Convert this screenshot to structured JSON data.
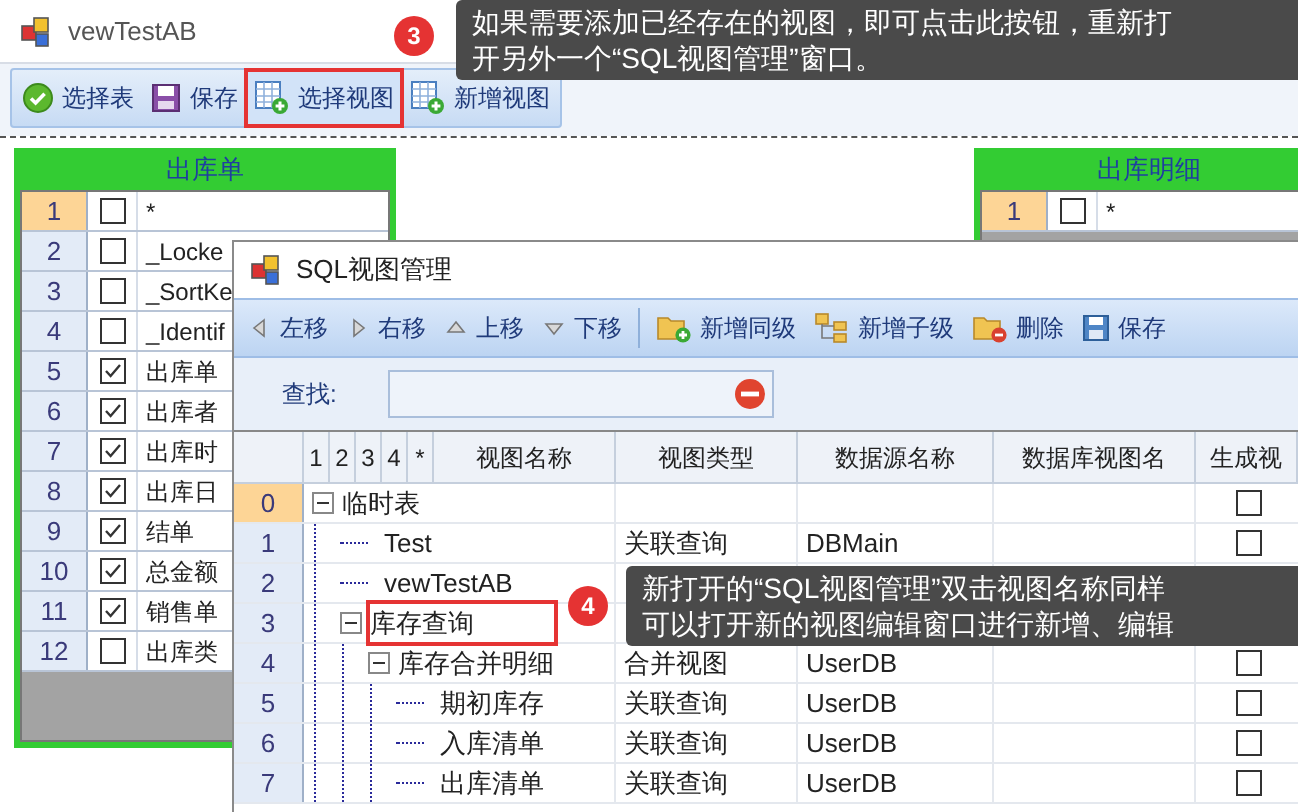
{
  "window": {
    "title": "vewTestAB"
  },
  "toolbar": [
    {
      "label": "选择表",
      "highlighted": false
    },
    {
      "label": "保存",
      "highlighted": false
    },
    {
      "label": "选择视图",
      "highlighted": true
    },
    {
      "label": "新增视图",
      "highlighted": false
    }
  ],
  "canvas_tables": [
    {
      "title": "出库单",
      "rows": [
        {
          "number": "1",
          "selected": true,
          "checked": false,
          "name": "*"
        },
        {
          "number": "2",
          "selected": false,
          "checked": false,
          "name": "_Locke"
        },
        {
          "number": "3",
          "selected": false,
          "checked": false,
          "name": "_SortKe"
        },
        {
          "number": "4",
          "selected": false,
          "checked": false,
          "name": "_Identif"
        },
        {
          "number": "5",
          "selected": false,
          "checked": true,
          "name": "出库单"
        },
        {
          "number": "6",
          "selected": false,
          "checked": true,
          "name": "出库者"
        },
        {
          "number": "7",
          "selected": false,
          "checked": true,
          "name": "出库时"
        },
        {
          "number": "8",
          "selected": false,
          "checked": true,
          "name": "出库日"
        },
        {
          "number": "9",
          "selected": false,
          "checked": true,
          "name": "结单"
        },
        {
          "number": "10",
          "selected": false,
          "checked": true,
          "name": "总金额"
        },
        {
          "number": "11",
          "selected": false,
          "checked": true,
          "name": "销售单"
        },
        {
          "number": "12",
          "selected": false,
          "checked": false,
          "name": "出库类"
        }
      ]
    },
    {
      "title": "出库明细",
      "rows": [
        {
          "number": "1",
          "selected": true,
          "checked": false,
          "name": "*"
        }
      ]
    }
  ],
  "sql_window": {
    "title": "SQL视图管理",
    "toolbar": [
      {
        "label": "左移"
      },
      {
        "label": "右移"
      },
      {
        "label": "上移"
      },
      {
        "label": "下移"
      },
      {
        "label": "新增同级"
      },
      {
        "label": "新增子级"
      },
      {
        "label": "删除"
      },
      {
        "label": "保存"
      }
    ],
    "search": {
      "label": "查找:"
    },
    "level_buttons": [
      "1",
      "2",
      "3",
      "4",
      "*"
    ],
    "columns": [
      "视图名称",
      "视图类型",
      "数据源名称",
      "数据库视图名",
      "生成视"
    ],
    "tree": [
      {
        "row": "0",
        "name": "临时表",
        "selected": true,
        "expanded": true,
        "checked": false,
        "children": [
          {
            "row": "1",
            "name": "Test",
            "selected": false,
            "type": "关联查询",
            "source": "DBMain",
            "checked": false
          },
          {
            "row": "2",
            "name": "vewTestAB",
            "selected": false
          },
          {
            "row": "3",
            "name": "库存查询",
            "selected": false,
            "highlighted": true,
            "expanded": true,
            "children": [
              {
                "row": "4",
                "name": "库存合并明细",
                "selected": false,
                "expanded": true,
                "type": "合并视图",
                "source": "UserDB",
                "checked": false,
                "children": [
                  {
                    "row": "5",
                    "name": "期初库存",
                    "selected": false,
                    "type": "关联查询",
                    "source": "UserDB",
                    "checked": false
                  },
                  {
                    "row": "6",
                    "name": "入库清单",
                    "selected": false,
                    "type": "关联查询",
                    "source": "UserDB",
                    "checked": false
                  },
                  {
                    "row": "7",
                    "name": "出库清单",
                    "selected": false,
                    "type": "关联查询",
                    "source": "UserDB",
                    "checked": false
                  }
                ]
              }
            ]
          }
        ]
      }
    ]
  },
  "callouts": [
    {
      "number": "3",
      "lines": [
        "如果需要添加已经存在的视图，即可点击此按钮，重新打",
        "开另外一个“SQL视图管理”窗口。"
      ]
    },
    {
      "number": "4",
      "lines": [
        "新打开的“SQL视图管理”双击视图名称同样",
        "可以打开新的视图编辑窗口进行新增、编辑"
      ]
    }
  ]
}
